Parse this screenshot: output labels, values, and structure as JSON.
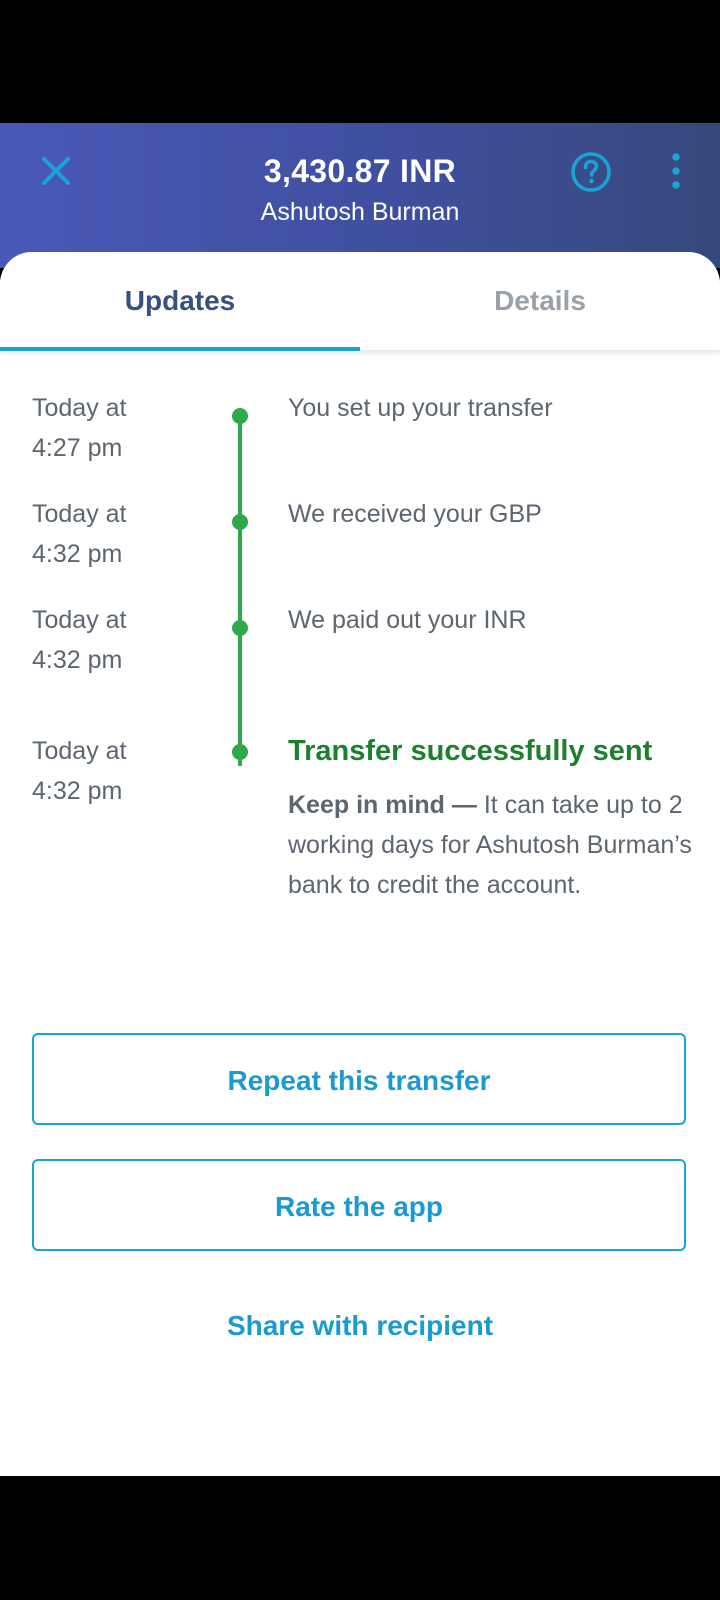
{
  "header": {
    "amount": "3,430.87 INR",
    "recipient": "Ashutosh Burman",
    "close_icon": "close-icon",
    "help_icon": "help-icon",
    "more_icon": "more-vertical-icon",
    "background_start": "#4a58b8",
    "background_end": "#36497d",
    "accent": "#1aa3d6"
  },
  "tabs": [
    {
      "label": "Updates",
      "active": true
    },
    {
      "label": "Details",
      "active": false
    }
  ],
  "timeline": [
    {
      "time_line1": "Today at",
      "time_line2": "4:27 pm",
      "text": "You set up your transfer"
    },
    {
      "time_line1": "Today at",
      "time_line2": "4:32 pm",
      "text": "We received your GBP"
    },
    {
      "time_line1": "Today at",
      "time_line2": "4:32 pm",
      "text": "We paid out your INR"
    },
    {
      "time_line1": "Today at",
      "time_line2": "4:32 pm",
      "text": "Transfer successfully sent"
    }
  ],
  "note": {
    "bold": "Keep in mind —",
    "text": " It can take up to 2 working days for Ashutosh Burman’s bank to credit the account."
  },
  "actions": {
    "repeat": "Repeat this transfer",
    "rate": "Rate the app",
    "share": "Share with recipient"
  },
  "colors": {
    "timeline_green": "#2ea84a",
    "success_text": "#1e7f2f",
    "link_blue": "#1a9ad0"
  }
}
